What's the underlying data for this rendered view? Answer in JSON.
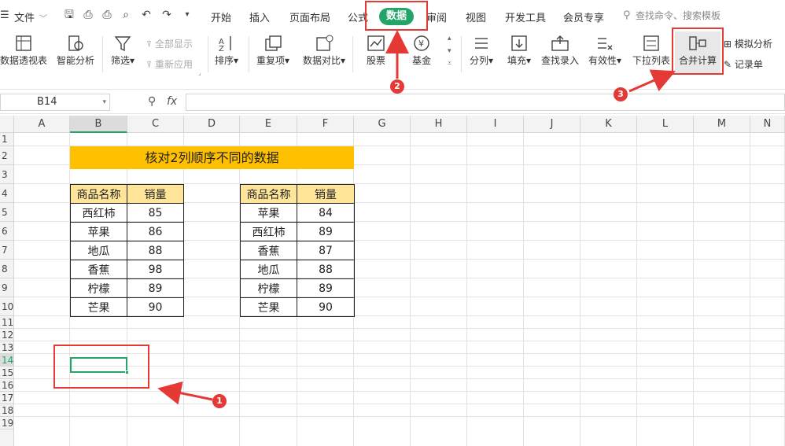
{
  "menubar": {
    "file_label": "文件",
    "tabs": [
      "开始",
      "插入",
      "页面布局",
      "公式",
      "数据",
      "审阅",
      "视图",
      "开发工具",
      "会员专享"
    ],
    "search_placeholder": "查找命令、搜索模板"
  },
  "ribbon": {
    "pivot": "数据透视表",
    "smart_analysis": "智能分析",
    "filter": "筛选",
    "show_all": "全部显示",
    "reapply": "重新应用",
    "sort": "排序",
    "duplicates": "重复项",
    "compare": "数据对比",
    "stock": "股票",
    "fund": "基金",
    "split": "分列",
    "fill": "填充",
    "lookup": "查找录入",
    "validity": "有效性",
    "dropdown": "下拉列表",
    "consolidate": "合并计算",
    "simulate": "模拟分析",
    "record": "记录单"
  },
  "formula_bar": {
    "cell_ref": "B14",
    "fx": "fx",
    "value": ""
  },
  "columns": [
    "A",
    "B",
    "C",
    "D",
    "E",
    "F",
    "G",
    "H",
    "I",
    "J",
    "K",
    "L",
    "M",
    "N"
  ],
  "rows": [
    "1",
    "2",
    "3",
    "4",
    "5",
    "6",
    "7",
    "8",
    "9",
    "10",
    "11",
    "12",
    "13",
    "14",
    "15",
    "16",
    "17",
    "18",
    "19"
  ],
  "sheet": {
    "title": "核对2列顺序不同的数据",
    "table1": {
      "headers": [
        "商品名称",
        "销量"
      ],
      "rows": [
        [
          "西红柿",
          "85"
        ],
        [
          "苹果",
          "86"
        ],
        [
          "地瓜",
          "88"
        ],
        [
          "香蕉",
          "98"
        ],
        [
          "柠檬",
          "89"
        ],
        [
          "芒果",
          "90"
        ]
      ]
    },
    "table2": {
      "headers": [
        "商品名称",
        "销量"
      ],
      "rows": [
        [
          "苹果",
          "84"
        ],
        [
          "西红柿",
          "89"
        ],
        [
          "香蕉",
          "87"
        ],
        [
          "地瓜",
          "88"
        ],
        [
          "柠檬",
          "89"
        ],
        [
          "芒果",
          "90"
        ]
      ]
    }
  },
  "annotations": {
    "step1": "1",
    "step2": "2",
    "step3": "3"
  },
  "colors": {
    "accent": "#22a566",
    "highlight_red": "#e53935",
    "title_fill": "#ffc000",
    "header_fill": "#ffe599"
  }
}
